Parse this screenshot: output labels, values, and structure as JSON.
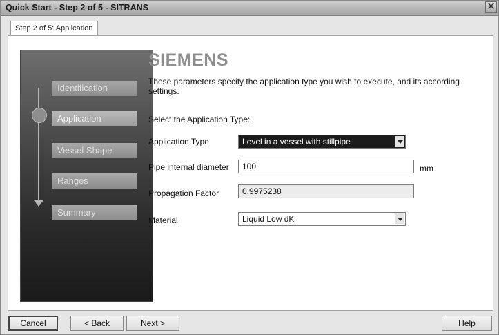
{
  "window": {
    "title": "Quick Start - Step 2 of 5 - SITRANS",
    "close_glyph": "✕"
  },
  "tab": {
    "label": "Step 2 of 5: Application"
  },
  "nav": {
    "items": [
      {
        "label": "Identification",
        "active": false
      },
      {
        "label": "Application",
        "active": true
      },
      {
        "label": "Vessel Shape",
        "active": false
      },
      {
        "label": "Ranges",
        "active": false
      },
      {
        "label": "Summary",
        "active": false
      }
    ]
  },
  "content": {
    "brand": "SIEMENS",
    "description": "These parameters specify the application type you wish to execute, and its according settings.",
    "select_prompt": "Select the Application Type:",
    "fields": {
      "application_type": {
        "label": "Application Type",
        "value": "Level in a vessel with stillpipe"
      },
      "pipe_diameter": {
        "label": "Pipe internal diameter",
        "value": "100",
        "unit": "mm"
      },
      "propagation_factor": {
        "label": "Propagation Factor",
        "value": "0.9975238"
      },
      "material": {
        "label": "Material",
        "value": "Liquid Low dK"
      }
    }
  },
  "buttons": {
    "cancel": "Cancel",
    "back": "< Back",
    "next": "Next >",
    "help": "Help"
  },
  "colors": {
    "brand": "#8e8e8e",
    "highlight": "#1c1c1c"
  }
}
